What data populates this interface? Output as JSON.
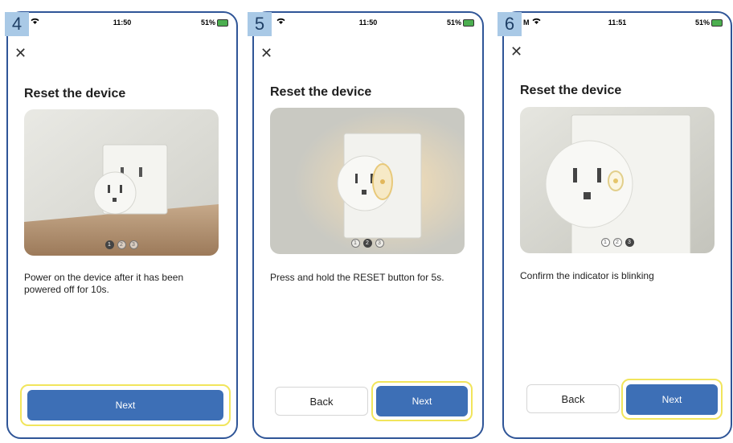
{
  "screens": [
    {
      "step": "4",
      "status": {
        "time": "11:50",
        "battery": "51%"
      },
      "title": "Reset the device",
      "description": "Power on the device after it has been powered off for 10s.",
      "buttons": {
        "next": "Next"
      },
      "pager": [
        "1",
        "2",
        "3"
      ],
      "active_page": 1
    },
    {
      "step": "5",
      "status": {
        "time": "11:50",
        "battery": "51%"
      },
      "title": "Reset the device",
      "description": "Press and hold the RESET button for 5s.",
      "buttons": {
        "back": "Back",
        "next": "Next"
      },
      "pager": [
        "1",
        "2",
        "3"
      ],
      "active_page": 2
    },
    {
      "step": "6",
      "status": {
        "carrier": "M",
        "time": "11:51",
        "battery": "51%"
      },
      "title": "Reset the device",
      "description": "Confirm the indicator is blinking",
      "buttons": {
        "back": "Back",
        "next": "Next"
      },
      "pager": [
        "1",
        "2",
        "3"
      ],
      "active_page": 3
    }
  ],
  "colors": {
    "frame": "#2f5597",
    "badge": "#a9c9e6",
    "next_button": "#3d6fb6",
    "highlight": "#f1e55c"
  },
  "icons": [
    "wifi-icon",
    "battery-icon",
    "close-icon"
  ]
}
